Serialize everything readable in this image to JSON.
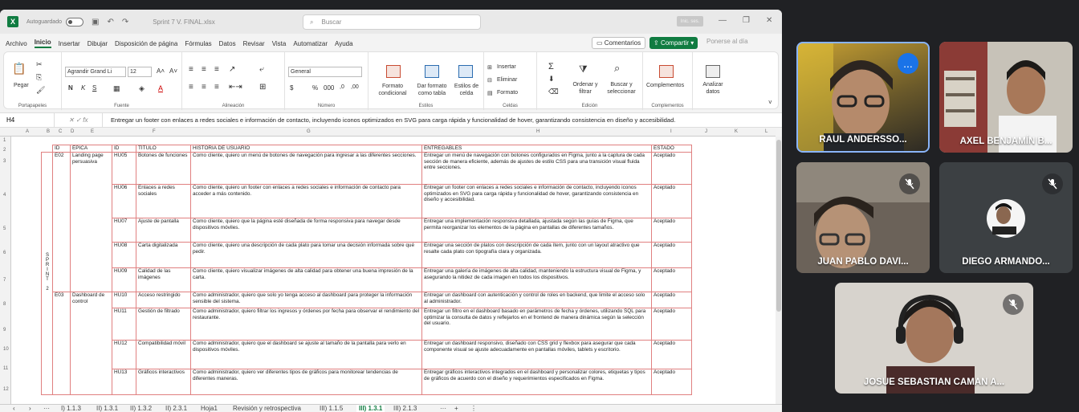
{
  "excel": {
    "autosave_label": "Autoguardado",
    "filename": "Sprint 7 V. FINAL.xlsx",
    "search_placeholder": "Buscar",
    "signin_label": "Inic. ses.",
    "menu": [
      "Archivo",
      "Inicio",
      "Insertar",
      "Dibujar",
      "Disposición de página",
      "Fórmulas",
      "Datos",
      "Revisar",
      "Vista",
      "Automatizar",
      "Ayuda"
    ],
    "active_menu": "Inicio",
    "comments_label": "Comentarios",
    "share_label": "Compartir",
    "offline_label": "Ponerse al día",
    "ribbon": {
      "paste": "Pegar",
      "clipboard": "Portapapeles",
      "font_name": "Agrandir Grand Li",
      "font_size": "12",
      "font_group": "Fuente",
      "alignment_group": "Alineación",
      "number_format": "General",
      "number_group": "Número",
      "conditional_format": "Formato condicional",
      "format_table": "Dar formato como tabla",
      "cell_styles": "Estilos de celda",
      "styles_group": "Estilos",
      "insert": "Insertar",
      "delete": "Eliminar",
      "format": "Formato",
      "cells_group": "Celdas",
      "sort_filter": "Ordenar y filtrar",
      "find_select": "Buscar y seleccionar",
      "editing_group": "Edición",
      "addins": "Complementos",
      "addins_group": "Complementos",
      "analyze": "Analizar datos"
    },
    "name_box": "H4",
    "formula_text": "Entregar un footer con enlaces a redes sociales e información de contacto, incluyendo iconos optimizados en SVG para carga rápida y funcionalidad de hover, garantizando consistencia en diseño y accesibilidad.",
    "columns": [
      "A",
      "B",
      "C",
      "D",
      "E",
      "F",
      "G",
      "H",
      "I",
      "J",
      "K",
      "L"
    ],
    "rows": [
      "1",
      "2",
      "3",
      "4",
      "5",
      "6",
      "7",
      "8",
      "9",
      "10",
      "11",
      "12"
    ],
    "table": {
      "headers": [
        "ID",
        "ÉPICA",
        "ID",
        "TÍTULO",
        "HISTORIA DE USUARIO",
        "ENTREGABLES",
        "ESTADO"
      ],
      "sprint_label": "SPRINT 2",
      "epics": [
        {
          "id": "E02",
          "name": "Landing page persuasiva"
        },
        {
          "id": "E03",
          "name": "Dashboard de control"
        }
      ],
      "stories": [
        {
          "id": "HU05",
          "title": "Botones de funciones",
          "story": "Como cliente, quiero un menú de botones de navegación para ingresar a las diferentes secciones.",
          "deliverable": "Entregar un menú de navegación con botones configurados en Figma, junto a la captura de cada sección de manera eficiente, además de ajustes de estilo CSS para una transición visual fluida entre secciones.",
          "status": "Aceptado"
        },
        {
          "id": "HU06",
          "title": "Enlaces a redes sociales",
          "story": "Como cliente, quiero un footer con enlaces a redes sociales e información de contacto para acceder a más contenido.",
          "deliverable": "Entregar un footer con enlaces a redes sociales e información de contacto, incluyendo iconos optimizados en SVG para carga rápida y funcionalidad de hover, garantizando consistencia en diseño y accesibilidad.",
          "status": "Aceptado"
        },
        {
          "id": "HU07",
          "title": "Ajuste de pantalla",
          "story": "Como cliente, quiero que la página esté diseñada de forma responsiva para navegar desde dispositivos móviles.",
          "deliverable": "Entregar una implementación responsiva detallada, ajustada según las guías de Figma, que permita reorganizar los elementos de la página en pantallas de diferentes tamaños.",
          "status": "Aceptado"
        },
        {
          "id": "HU08",
          "title": "Carta digitalizada",
          "story": "Como cliente, quiero una descripción de cada plato para tomar una decisión informada sobre qué pedir.",
          "deliverable": "Entregar una sección de platos con descripción de cada ítem, junto con un layout atractivo que resalte cada plato con tipografía clara y organizada.",
          "status": "Aceptado"
        },
        {
          "id": "HU09",
          "title": "Calidad de las imágenes",
          "story": "Como cliente, quiero visualizar imágenes de alta calidad para obtener una buena impresión de la carta.",
          "deliverable": "Entregar una galería de imágenes de alta calidad, manteniendo la estructura visual de Figma, y asegurando la nitidez de cada imagen en todos los dispositivos.",
          "status": "Aceptado"
        },
        {
          "id": "HU10",
          "title": "Acceso restringido",
          "story": "Como administrador, quiero que solo yo tenga acceso al dashboard para proteger la información sensible del sistema.",
          "deliverable": "Entregar un dashboard con autenticación y control de roles en backend, que limite el acceso solo al administrador.",
          "status": "Aceptado"
        },
        {
          "id": "HU11",
          "title": "Gestión de filtrado",
          "story": "Como administrador, quiero filtrar los ingresos y órdenes por fecha para observar el rendimiento del restaurante.",
          "deliverable": "Entregar un filtro en el dashboard basado en parámetros de fecha y órdenes, utilizando SQL para optimizar la consulta de datos y reflejarlos en el frontend de manera dinámica según la selección del usuario.",
          "status": "Aceptado"
        },
        {
          "id": "HU12",
          "title": "Compatibilidad móvil",
          "story": "Como administrador, quiero que el dashboard se ajuste al tamaño de la pantalla para verlo en dispositivos móviles.",
          "deliverable": "Entregar un dashboard responsivo, diseñado con CSS grid y flexbox para asegurar que cada componente visual se ajuste adecuadamente en pantallas móviles, tablets y escritorio.",
          "status": "Aceptado"
        },
        {
          "id": "HU13",
          "title": "Gráficos interactivos",
          "story": "Como administrador, quiero ver diferentes tipos de gráficos para monitorear tendencias de diferentes maneras.",
          "deliverable": "Entregar gráficos interactivos integrados en el dashboard y personalizar colores, etiquetas y tipos de gráficos de acuerdo con el diseño y requerimientos especificados en Figma.",
          "status": "Aceptado"
        }
      ]
    },
    "sheet_tabs": [
      "I) 1.1.3",
      "II) 1.3.1",
      "II) 1.3.2",
      "II) 2.3.1",
      "Hoja1",
      "Revisión y retrospectiva",
      "III) 1.1.5",
      "III) 1.3.1",
      "III) 2.1.3"
    ],
    "active_sheet": "III) 1.3.1"
  },
  "meet": {
    "participants": [
      {
        "name": "RAUL ANDERSSO...",
        "muted": false,
        "speaking": true,
        "more_label": "..."
      },
      {
        "name": "AXEL BENJAMÍN B...",
        "muted": false,
        "speaking": false
      },
      {
        "name": "JUAN PABLO DAVI...",
        "muted": true,
        "speaking": false
      },
      {
        "name": "DIEGO ARMANDO...",
        "muted": true,
        "speaking": false
      },
      {
        "name": "JOSUE SEBASTIAN CAMAN A...",
        "muted": true,
        "speaking": false
      }
    ]
  },
  "colors": {
    "excel_green": "#107c41",
    "meet_bg": "#202124",
    "speaking_border": "#8ab4f8",
    "table_border": "#e08080"
  }
}
